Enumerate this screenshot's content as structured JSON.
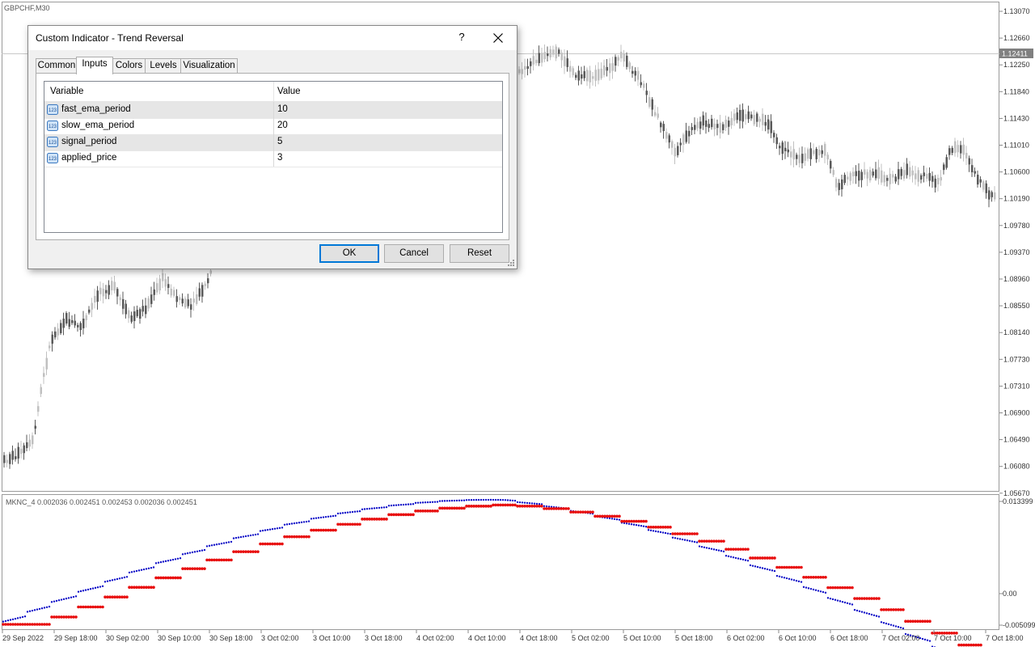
{
  "chart": {
    "symbol": "GBPCHF,M30",
    "price_labels": [
      "1.13070",
      "1.12660",
      "1.12250",
      "1.11840",
      "1.11430",
      "1.11010",
      "1.10600",
      "1.10190",
      "1.09780",
      "1.09370",
      "1.08960",
      "1.08550",
      "1.08140",
      "1.07730",
      "1.07310",
      "1.06900",
      "1.06490",
      "1.06080",
      "1.05670"
    ],
    "current_price": "1.12411",
    "time_labels": [
      "29 Sep 2022",
      "29 Sep 18:00",
      "30 Sep 02:00",
      "30 Sep 10:00",
      "30 Sep 18:00",
      "3 Oct 02:00",
      "3 Oct 10:00",
      "3 Oct 18:00",
      "4 Oct 02:00",
      "4 Oct 10:00",
      "4 Oct 18:00",
      "5 Oct 02:00",
      "5 Oct 10:00",
      "5 Oct 18:00",
      "6 Oct 02:00",
      "6 Oct 10:00",
      "6 Oct 18:00",
      "7 Oct 02:00",
      "7 Oct 10:00",
      "7 Oct 18:00"
    ],
    "indicator_label": "MKNC_4 0.002036 0.002451 0.002453 0.002036 0.002451",
    "indicator_scale": [
      "0.013399",
      "0.00",
      "-0.005099"
    ],
    "colors": {
      "bull": "#c0c0c0",
      "bear": "#5a5a5a",
      "line_fast": "#1010c8",
      "line_slow": "#e81010",
      "current_price_bg": "#808080"
    }
  },
  "dialog": {
    "title": "Custom Indicator - Trend Reversal",
    "help": "?",
    "tabs": [
      "Common",
      "Inputs",
      "Colors",
      "Levels",
      "Visualization"
    ],
    "active_tab": "Inputs",
    "columns": {
      "variable": "Variable",
      "value": "Value"
    },
    "params": [
      {
        "name": "fast_ema_period",
        "value": "10",
        "icon": "number-type-icon"
      },
      {
        "name": "slow_ema_period",
        "value": "20",
        "icon": "number-type-icon"
      },
      {
        "name": "signal_period",
        "value": "5",
        "icon": "number-type-icon"
      },
      {
        "name": "applied_price",
        "value": "3",
        "icon": "number-type-icon"
      }
    ],
    "buttons": {
      "ok": "OK",
      "cancel": "Cancel",
      "reset": "Reset"
    }
  }
}
